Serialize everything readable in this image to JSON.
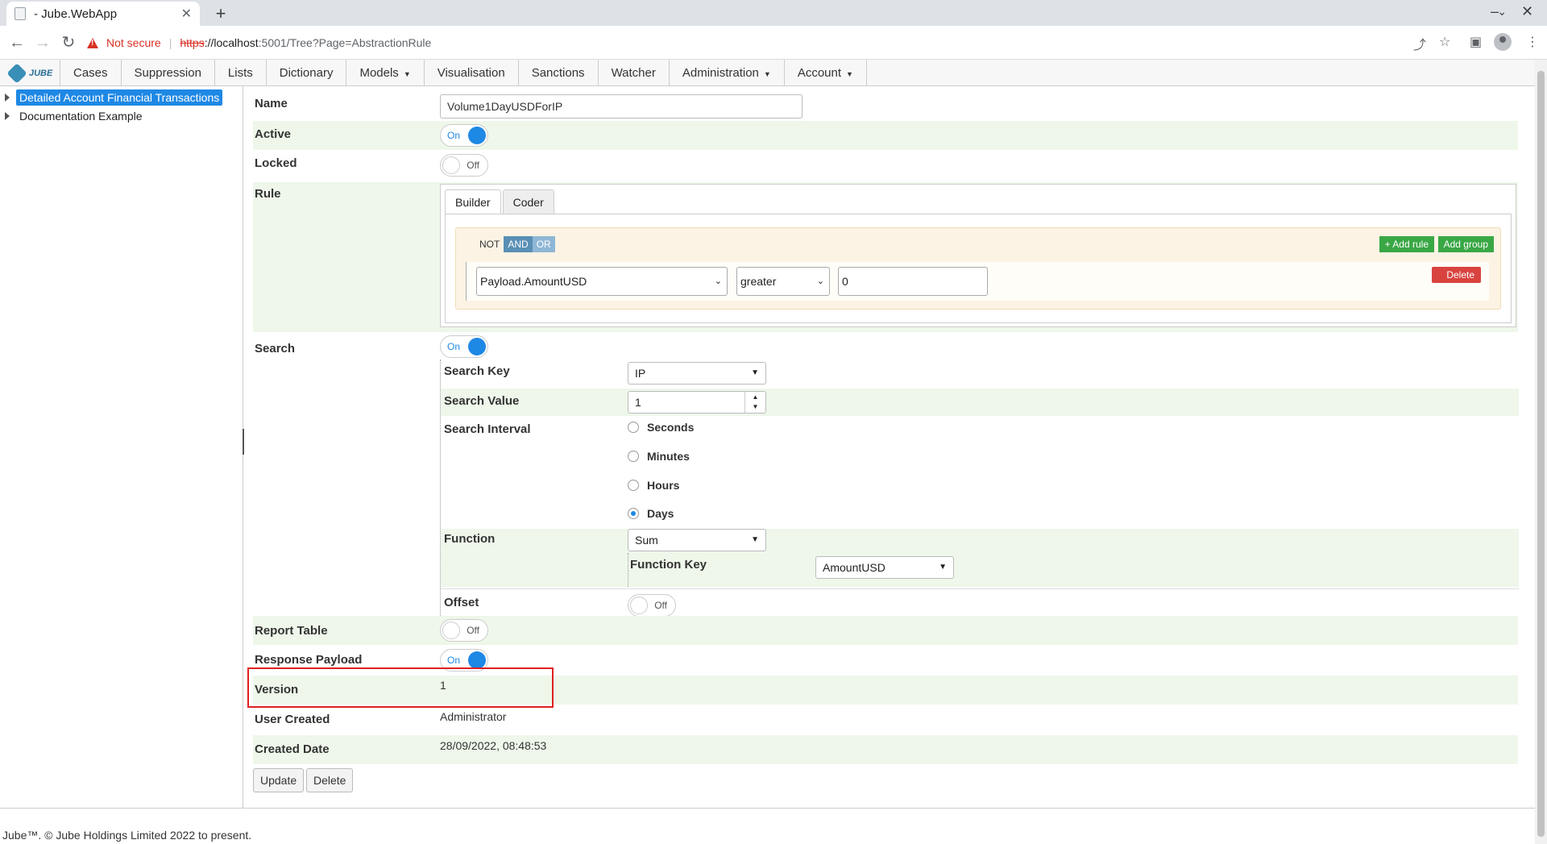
{
  "browser": {
    "tab_title": "- Jube.WebApp",
    "tab_close": "✕",
    "new_tab": "+",
    "not_secure": "Not secure",
    "url_scheme": "https",
    "url_host": "://localhost",
    "url_path": ":5001/Tree?Page=AbstractionRule"
  },
  "nav": {
    "logo": "JUBE",
    "items": [
      "Cases",
      "Suppression",
      "Lists",
      "Dictionary",
      "Models",
      "Visualisation",
      "Sanctions",
      "Watcher",
      "Administration",
      "Account"
    ]
  },
  "tree": {
    "items": [
      "Detailed Account Financial Transactions",
      "Documentation Example"
    ]
  },
  "form": {
    "name_label": "Name",
    "name_value": "Volume1DayUSDForIP",
    "active_label": "Active",
    "active_state": "On",
    "locked_label": "Locked",
    "locked_state": "Off",
    "rule_label": "Rule",
    "rule": {
      "tabs": [
        "Builder",
        "Coder"
      ],
      "not": "NOT",
      "and": "AND",
      "or": "OR",
      "add_rule": "+ Add rule",
      "add_group": "Add group",
      "field": "Payload.AmountUSD",
      "operator": "greater",
      "value": "0",
      "delete": "Delete"
    },
    "search_label": "Search",
    "search_state": "On",
    "search_key_label": "Search Key",
    "search_key_value": "IP",
    "search_value_label": "Search Value",
    "search_value": "1",
    "search_interval_label": "Search Interval",
    "intervals": [
      "Seconds",
      "Minutes",
      "Hours",
      "Days"
    ],
    "interval_selected": "Days",
    "function_label": "Function",
    "function_value": "Sum",
    "function_key_label": "Function Key",
    "function_key_value": "AmountUSD",
    "offset_label": "Offset",
    "offset_state": "Off",
    "report_table_label": "Report Table",
    "report_table_state": "Off",
    "response_payload_label": "Response Payload",
    "response_payload_state": "On",
    "version_label": "Version",
    "version_value": "1",
    "user_created_label": "User Created",
    "user_created_value": "Administrator",
    "created_date_label": "Created Date",
    "created_date_value": "28/09/2022, 08:48:53",
    "update_button": "Update",
    "delete_button": "Delete"
  },
  "footer": "Jube™. © Jube Holdings Limited 2022 to present.",
  "colors": {
    "accent": "#1e88e5",
    "row_highlight": "#eef7ea",
    "annotation": "#e02020"
  }
}
